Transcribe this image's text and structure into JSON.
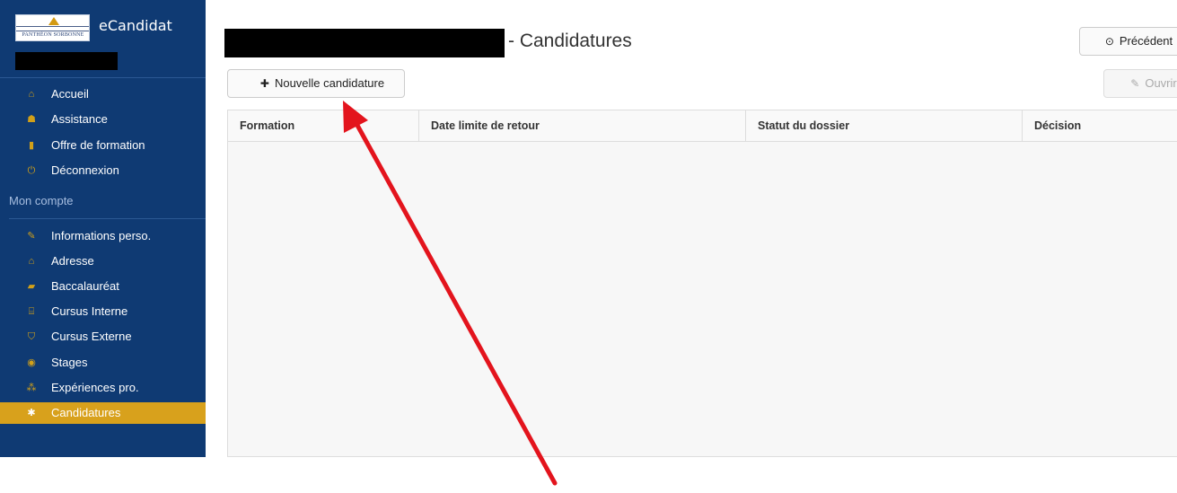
{
  "sidebar": {
    "logo_text": "PANTHÉON SORBONNE",
    "brand": "eCandidat",
    "items": [
      {
        "icon": "home-icon",
        "glyph": "⌂",
        "label": "Accueil"
      },
      {
        "icon": "assistance-icon",
        "glyph": "☗",
        "label": "Assistance"
      },
      {
        "icon": "bookmark-icon",
        "glyph": "▮",
        "label": "Offre de formation"
      },
      {
        "icon": "power-icon",
        "glyph": "⏻",
        "label": "Déconnexion"
      }
    ],
    "section_label": "Mon compte",
    "account_items": [
      {
        "icon": "pencil-icon",
        "glyph": "✎",
        "label": "Informations perso."
      },
      {
        "icon": "home-icon",
        "glyph": "⌂",
        "label": "Adresse"
      },
      {
        "icon": "book-icon",
        "glyph": "▰",
        "label": "Baccalauréat"
      },
      {
        "icon": "institution-icon",
        "glyph": "⌸",
        "label": "Cursus Interne"
      },
      {
        "icon": "graduation-cap-icon",
        "glyph": "⛉",
        "label": "Cursus Externe"
      },
      {
        "icon": "cube-icon",
        "glyph": "◉",
        "label": "Stages"
      },
      {
        "icon": "cubes-icon",
        "glyph": "⁂",
        "label": "Expériences pro."
      },
      {
        "icon": "asterisk-icon",
        "glyph": "✱",
        "label": "Candidatures"
      }
    ]
  },
  "header": {
    "title": "- Candidatures",
    "prev_label": "Précédent",
    "prev_icon": "⊙"
  },
  "toolbar": {
    "new_label": "Nouvelle candidature",
    "new_icon": "✚",
    "open_label": "Ouvrir",
    "open_icon": "✎"
  },
  "table": {
    "columns": [
      "Formation",
      "Date limite de retour",
      "Statut du dossier",
      "Décision"
    ]
  },
  "colors": {
    "sidebar_bg": "#0f3a73",
    "active_item": "#d8a11c",
    "arrow": "#e3141d"
  }
}
